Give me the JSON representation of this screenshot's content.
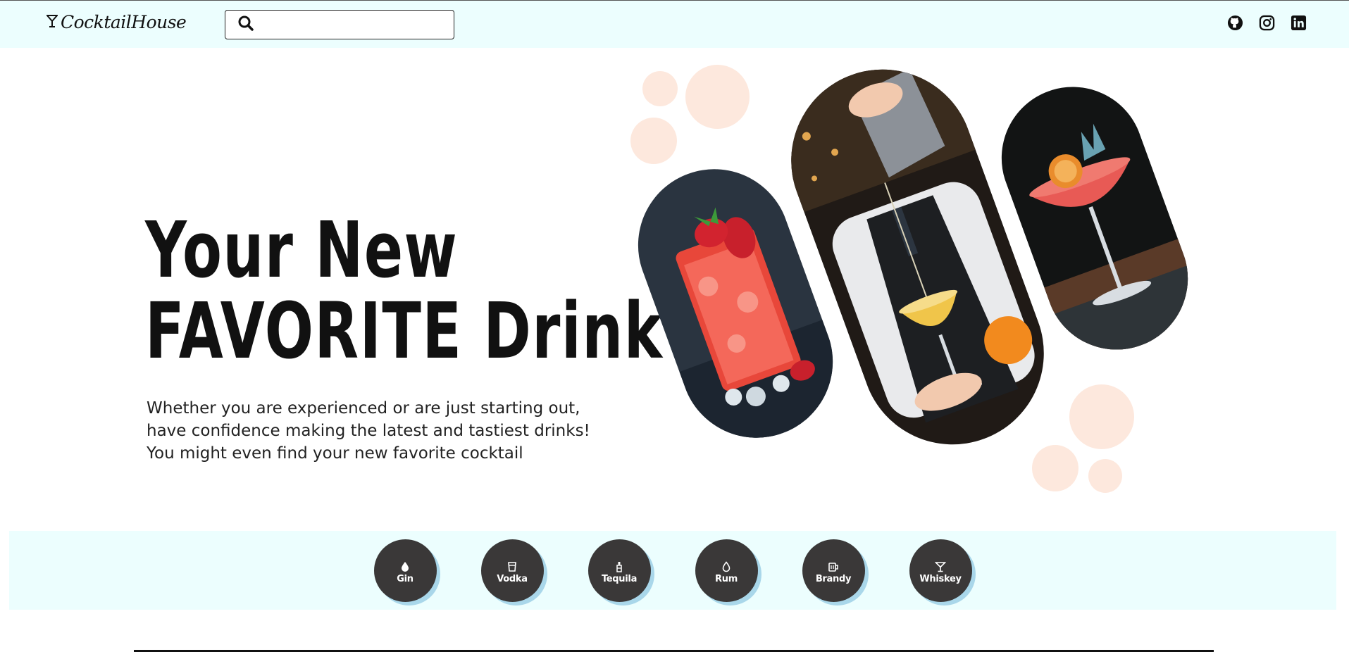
{
  "header": {
    "brand_name": "CocktailHouse",
    "search": {
      "placeholder": "",
      "value": ""
    },
    "socials": [
      {
        "name": "github-icon"
      },
      {
        "name": "instagram-icon"
      },
      {
        "name": "linkedin-icon"
      }
    ]
  },
  "hero": {
    "title_line1": "Your New",
    "title_line2": "FAVORITE Drink",
    "subtitle_line1": "Whether you are experienced or are just starting out,",
    "subtitle_line2": "have confidence making the latest and tastiest drinks!",
    "subtitle_line3": "You might even find your new favorite cocktail"
  },
  "categories": [
    {
      "label": "Gin",
      "icon": "drop-icon"
    },
    {
      "label": "Vodka",
      "icon": "shot-glass-icon"
    },
    {
      "label": "Tequila",
      "icon": "bottle-icon"
    },
    {
      "label": "Rum",
      "icon": "drop-outline-icon"
    },
    {
      "label": "Brandy",
      "icon": "mug-icon"
    },
    {
      "label": "Whiskey",
      "icon": "martini-icon"
    }
  ],
  "colors": {
    "header_bg": "#ecfefe",
    "category_bg": "#3a3838",
    "category_shadow": "#a9d7ea",
    "blob": "#fde8dd"
  }
}
